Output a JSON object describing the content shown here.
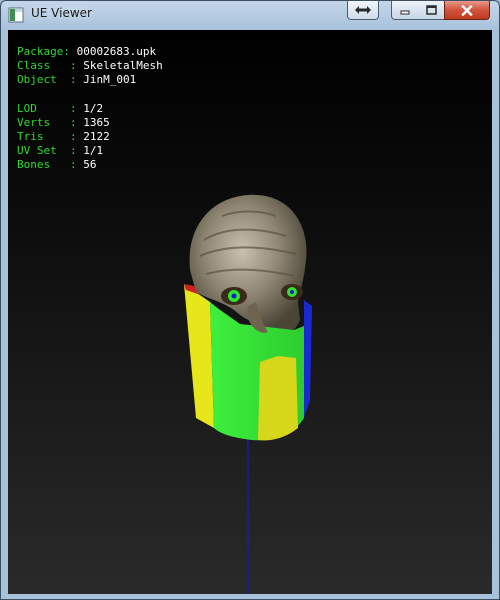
{
  "window": {
    "title": "UE Viewer",
    "controls": [
      "swap-icon",
      "minimize-icon",
      "maximize-icon",
      "close-icon"
    ]
  },
  "info": {
    "package_label": "Package",
    "package_value": "00002683.upk",
    "class_label": "Class",
    "class_value": "SkeletalMesh",
    "object_label": "Object",
    "object_value": "JinM_001",
    "lod_label": "LOD",
    "lod_value": "1/2",
    "verts_label": "Verts",
    "verts_value": "1365",
    "tris_label": "Tris",
    "tris_value": "2122",
    "uvset_label": "UV Set",
    "uvset_value": "1/1",
    "bones_label": "Bones",
    "bones_value": "56"
  },
  "colors": {
    "label_green": "#2fd92f",
    "value_white": "#ffffff",
    "mesh_green": "#39e639",
    "mesh_yellow": "#e6e61a",
    "axis_blue": "#1a1aa6"
  }
}
